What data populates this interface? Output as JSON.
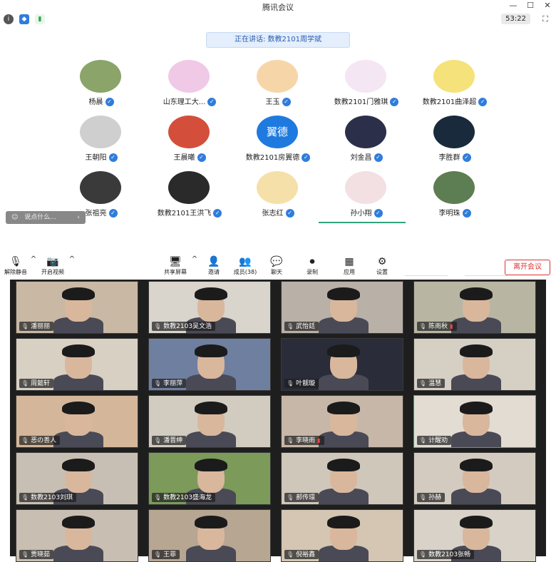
{
  "window": {
    "title": "腾讯会议",
    "min": "—",
    "max": "☐",
    "close": "✕"
  },
  "infobar": {
    "timer": "53:22"
  },
  "speaking": "正在讲话: 数教2101周学斌",
  "participants": [
    {
      "name": "杨晨",
      "color": "#8aa46a"
    },
    {
      "name": "山东理工大...",
      "color": "#f0c9e6"
    },
    {
      "name": "王玉",
      "color": "#f6d6a8"
    },
    {
      "name": "数教2101门雅琪",
      "color": "#f4e6f2"
    },
    {
      "name": "数教2101曲泽超",
      "color": "#f6e27a"
    },
    {
      "name": "王朝阳",
      "color": "#cfcfcf"
    },
    {
      "name": "王晨曦",
      "color": "#d44e3c"
    },
    {
      "name": "数教2101房翼德",
      "color": "#1f7ae0",
      "text": "翼德"
    },
    {
      "name": "刘金昌",
      "color": "#2b2f4a"
    },
    {
      "name": "李胜群",
      "color": "#182a3c"
    },
    {
      "name": "张祖亮",
      "color": "#3a3a3a"
    },
    {
      "name": "数教2101王洪飞",
      "color": "#2a2a2a"
    },
    {
      "name": "张志红",
      "color": "#f4e0a8"
    },
    {
      "name": "孙小翔",
      "color": "#f2e0e2"
    },
    {
      "name": "李明珠",
      "color": "#5d7d52"
    }
  ],
  "chat": {
    "placeholder": "说点什么..."
  },
  "toolbar": {
    "unmute": "解除静音",
    "start_video": "开启视频",
    "share": "共享屏幕",
    "invite": "邀请",
    "members": "成员(38)",
    "chat": "聊天",
    "record": "录制",
    "apps": "应用",
    "settings": "设置",
    "leave": "离开会议"
  },
  "videos": [
    {
      "name": "潘丽丽",
      "bg": "#c9b8a4"
    },
    {
      "name": "数教2103吴文浩",
      "bg": "#d9d4cc"
    },
    {
      "name": "武怡廷",
      "bg": "#b9b0a8"
    },
    {
      "name": "陈雨秋",
      "bg": "#b8b6a2"
    },
    {
      "name": "周懿轩",
      "bg": "#d8d0c2"
    },
    {
      "name": "李丽萍",
      "bg": "#6f7fa0"
    },
    {
      "name": "叶靓璇",
      "bg": "#2a2c3a"
    },
    {
      "name": "温慧",
      "bg": "#d6cfc4"
    },
    {
      "name": "恶の善人",
      "bg": "#d4b69a"
    },
    {
      "name": "潘晋绅",
      "bg": "#d2cbc0"
    },
    {
      "name": "李晓雨",
      "bg": "#c7b7a8"
    },
    {
      "name": "计醒劝",
      "bg": "#e2dcd2"
    },
    {
      "name": "数教2103刘琪",
      "bg": "#c8bfb4"
    },
    {
      "name": "数教2103盛海龙",
      "bg": "#7c9a5a"
    },
    {
      "name": "郝传璟",
      "bg": "#cfc7ba"
    },
    {
      "name": "孙赫",
      "bg": "#d3cbc0"
    },
    {
      "name": "贾晓茹",
      "bg": "#c8beb2"
    },
    {
      "name": "王菲",
      "bg": "#b6a692"
    },
    {
      "name": "倪裕鑫",
      "bg": "#d4c6b2"
    },
    {
      "name": "数教2103张畅",
      "bg": "#d8d2c8"
    }
  ]
}
